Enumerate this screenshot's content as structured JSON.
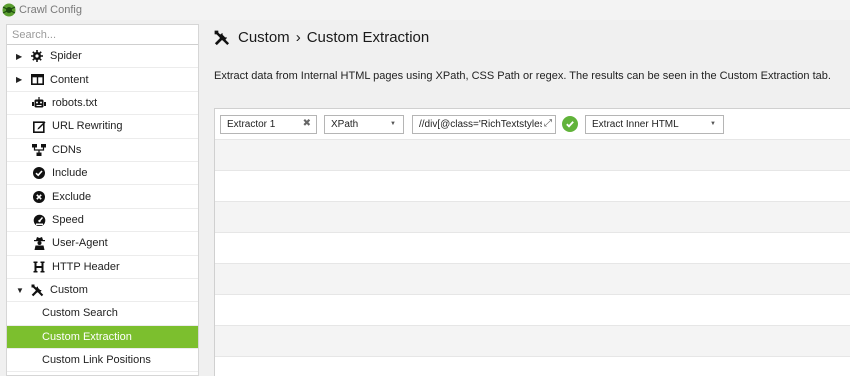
{
  "window": {
    "title": "Crawl Config"
  },
  "sidebar": {
    "search_placeholder": "Search...",
    "items": [
      {
        "label": "Spider",
        "icon": "gear-icon",
        "arrow": "collapsed"
      },
      {
        "label": "Content",
        "icon": "content-icon",
        "arrow": "collapsed"
      },
      {
        "label": "robots.txt",
        "icon": "robot-icon"
      },
      {
        "label": "URL Rewriting",
        "icon": "edit-icon"
      },
      {
        "label": "CDNs",
        "icon": "network-icon"
      },
      {
        "label": "Include",
        "icon": "check-circle-icon"
      },
      {
        "label": "Exclude",
        "icon": "x-circle-icon"
      },
      {
        "label": "Speed",
        "icon": "speedometer-icon"
      },
      {
        "label": "User-Agent",
        "icon": "user-secret-icon"
      },
      {
        "label": "HTTP Header",
        "icon": "h-icon"
      },
      {
        "label": "Custom",
        "icon": "tools-icon",
        "arrow": "expanded"
      },
      {
        "label": "Custom Search"
      },
      {
        "label": "Custom Extraction",
        "selected": true
      },
      {
        "label": "Custom Link Positions"
      }
    ]
  },
  "header": {
    "breadcrumb_parent": "Custom",
    "separator": "›",
    "breadcrumb_current": "Custom Extraction"
  },
  "description": "Extract data from Internal HTML pages using XPath, CSS Path or regex. The results can be seen in the Custom Extraction tab.",
  "extractor": {
    "name": "Extractor 1",
    "type": "XPath",
    "expression": "//div[@class='RichTextstyles",
    "mode": "Extract Inner HTML"
  },
  "colors": {
    "accent": "#7cbf2e",
    "valid": "#61b33a"
  }
}
